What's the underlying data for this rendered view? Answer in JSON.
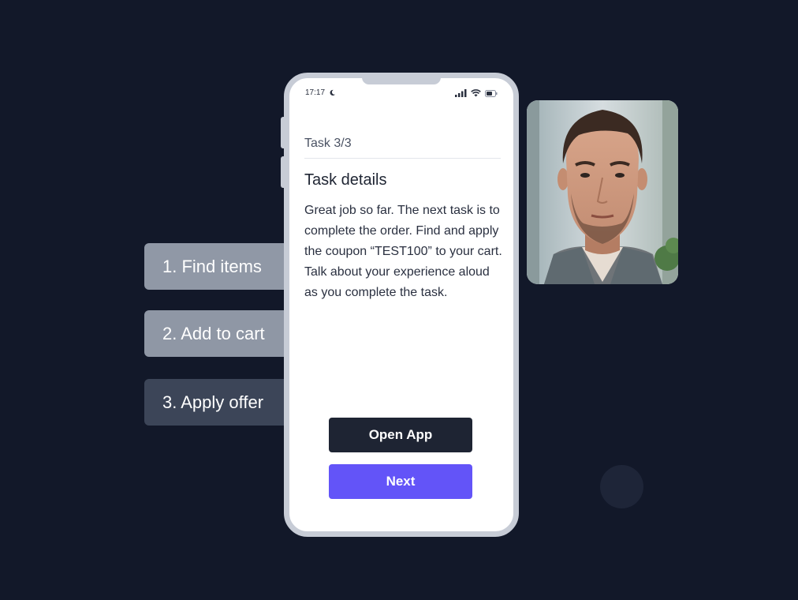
{
  "steps": [
    {
      "label": "1. Find items"
    },
    {
      "label": "2. Add to cart"
    },
    {
      "label": "3. Apply offer"
    }
  ],
  "phone": {
    "status_bar": {
      "time": "17:17",
      "icons": [
        "moon-icon",
        "signal-icon",
        "wifi-icon",
        "battery-icon"
      ]
    },
    "task_counter": "Task 3/3",
    "task_title": "Task details",
    "task_description": "Great job so far. The next task is to complete the order. Find and apply the coupon “TEST100” to your cart. Talk about your experience aloud as you complete the task.",
    "buttons": {
      "open_app": "Open App",
      "next": "Next"
    }
  },
  "video": {
    "description_icon": "participant-video"
  },
  "colors": {
    "background": "#121829",
    "accent": "#6354f8",
    "dark_button": "#1e2433",
    "step_active": "#3c4558",
    "step_inactive": "#9098a6"
  }
}
